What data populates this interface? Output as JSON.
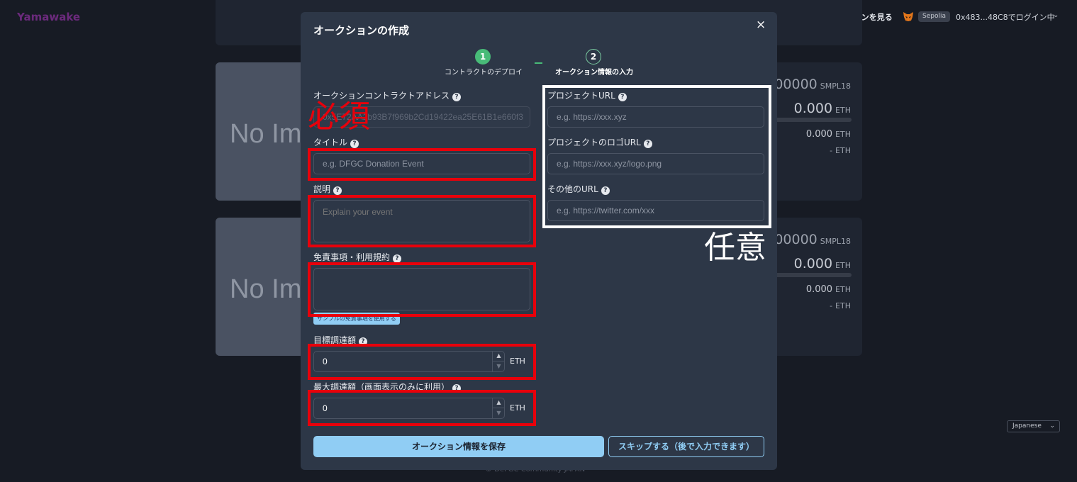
{
  "header": {
    "brand": "Yamawake",
    "nav_all_auctions": "すべてのオークションを見る",
    "network_badge": "Sepolia",
    "account": "0x483...48C8でログイン中",
    "wallet_icon": "fox-icon",
    "chevron_icon": "chevron-down-icon"
  },
  "background_cards": [
    {
      "image_text": "No Image",
      "token_amount": "00000",
      "token_unit": "SMPL18",
      "raised": "0.000",
      "raised_unit": "ETH",
      "sub_raised": "0.000",
      "sub_unit": "ETH",
      "target": "-",
      "target_unit": "ETH"
    },
    {
      "image_text": "No Image",
      "token_amount": "00000",
      "token_unit": "SMPL18",
      "raised": "0.000",
      "raised_unit": "ETH",
      "sub_raised": "0.000",
      "sub_unit": "ETH",
      "target": "-",
      "target_unit": "ETH"
    }
  ],
  "footer": {
    "language": "Japanese",
    "copyright": "© DeFGC Community JAPAN"
  },
  "modal": {
    "title": "オークションの作成",
    "close_icon": "×",
    "steps": [
      {
        "number": "1",
        "label": "コントラクトのデプロイ",
        "status": "completed"
      },
      {
        "number": "2",
        "label": "オークション情報の入力",
        "status": "active"
      }
    ],
    "help_glyph": "?",
    "fields": {
      "contract_address": {
        "label": "オークションコントラクトアドレス",
        "value": "0x5E72AA2b93B7f969b2Cd19422ea25E61B1e660f3"
      },
      "title": {
        "label": "タイトル",
        "placeholder": "e.g. DFGC Donation Event"
      },
      "description": {
        "label": "説明",
        "placeholder": "Explain your event"
      },
      "terms": {
        "label": "免責事項・利用規約",
        "placeholder": ""
      },
      "sample_terms_button": "サンプルの免責事項を使用する",
      "target_amount": {
        "label": "目標調達額",
        "value": "0",
        "unit": "ETH"
      },
      "max_amount": {
        "label": "最大調達額（画面表示のみに利用）",
        "value": "0",
        "unit": "ETH"
      },
      "project_url": {
        "label": "プロジェクトURL",
        "placeholder": "e.g. https://xxx.xyz"
      },
      "logo_url": {
        "label": "プロジェクトのロゴURL",
        "placeholder": "e.g. https://xxx.xyz/logo.png"
      },
      "other_url": {
        "label": "その他のURL",
        "placeholder": "e.g. https://twitter.com/xxx"
      }
    },
    "buttons": {
      "save": "オークション情報を保存",
      "skip": "スキップする（後で入力できます）"
    }
  },
  "annotations": {
    "required": "必須",
    "optional": "任意",
    "required_color": "#e8000b",
    "optional_color": "#ffffff"
  }
}
